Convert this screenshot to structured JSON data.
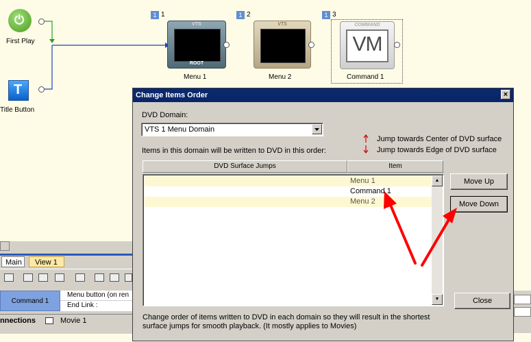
{
  "canvas": {
    "first_play_label": "First Play",
    "title_button_label": "Title Button",
    "nodes": [
      {
        "badge": "1",
        "num": "1",
        "caption_top": "VTS",
        "caption_bottom": "ROOT",
        "label": "Menu 1"
      },
      {
        "badge": "1",
        "num": "2",
        "caption_top": "VTS",
        "caption_bottom": "",
        "label": "Menu 2"
      },
      {
        "badge": "1",
        "num": "3",
        "caption_top": "COMMAND",
        "caption_bottom": "",
        "label": "Command 1",
        "vm_text": "VM"
      }
    ]
  },
  "dialog": {
    "title": "Change Items Order",
    "close_glyph": "×",
    "domain_label": "DVD Domain:",
    "domain_value": "VTS 1 Menu Domain",
    "legend_center": "Jump towards Center of DVD surface",
    "legend_edge": "Jump towards Edge of DVD surface",
    "order_note": "Items in this domain will be written to DVD in this order:",
    "col_jumps": "DVD Surface Jumps",
    "col_item": "Item",
    "rows": [
      "Menu 1",
      "Command 1",
      "Menu 2"
    ],
    "move_up": "Move Up",
    "move_down": "Move Down",
    "close": "Close",
    "footer": "Change order of items written to DVD in each domain so they will result in the shortest surface jumps for smooth playback. (It mostly applies to Movies)",
    "colors": {
      "arrow_up": "#cc0000",
      "arrow_down": "#cc0000",
      "annotation": "#ff0000"
    }
  },
  "app": {
    "tab_main": "Main",
    "tab_view": "View 1",
    "command_cell": "Command 1",
    "menu_button_text": "Menu button (on ren",
    "end_link_text": "End Link :",
    "connections_label": "nnections",
    "movie_tab": "Movie 1"
  }
}
